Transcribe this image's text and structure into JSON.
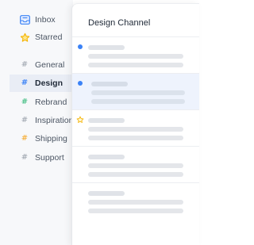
{
  "sidebar": {
    "items": [
      {
        "label": "Inbox",
        "icon": "inbox-icon",
        "color": "#3b82f6"
      },
      {
        "label": "Starred",
        "icon": "star-icon",
        "color": "#f5b301"
      },
      {
        "label": "General",
        "icon": "hash-icon",
        "color": "#9aa1ab"
      },
      {
        "label": "Design",
        "icon": "hash-icon",
        "color": "#3b82f6",
        "active": true
      },
      {
        "label": "Rebrand",
        "icon": "hash-icon",
        "color": "#2bb673"
      },
      {
        "label": "Inspiration",
        "icon": "hash-icon",
        "color": "#9aa1ab"
      },
      {
        "label": "Shipping",
        "icon": "hash-icon",
        "color": "#f5a623"
      },
      {
        "label": "Support",
        "icon": "hash-icon",
        "color": "#9aa1ab"
      }
    ]
  },
  "channel": {
    "title": "Design Channel",
    "accent": "#3b82f6",
    "messages": [
      {
        "marker": "unread-dot",
        "selected": false
      },
      {
        "marker": "unread-dot",
        "selected": true
      },
      {
        "marker": "star",
        "selected": false
      },
      {
        "marker": "none",
        "selected": false
      },
      {
        "marker": "none",
        "selected": false
      }
    ]
  }
}
